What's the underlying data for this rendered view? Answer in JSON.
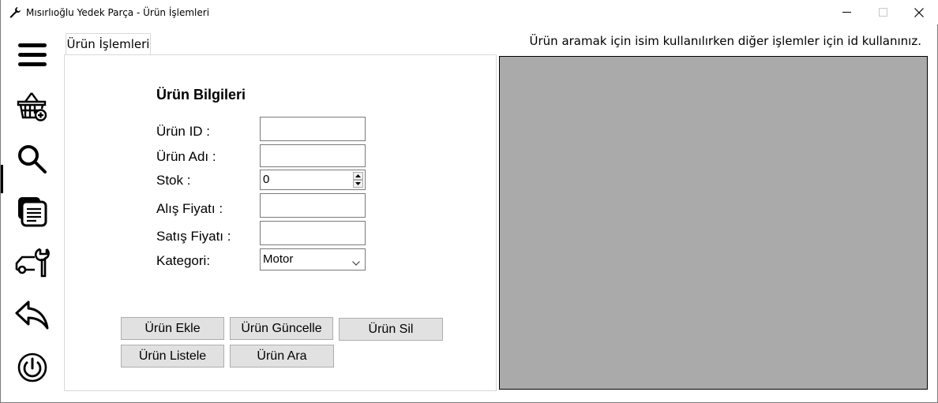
{
  "window": {
    "title": "Mısırlıoğlu Yedek Parça - Ürün İşlemleri",
    "icons": [
      "wrench-icon",
      "minimize-icon",
      "maximize-icon",
      "close-icon"
    ]
  },
  "sidebar": {
    "items": [
      {
        "icon": "menu-icon"
      },
      {
        "icon": "basket-add-icon"
      },
      {
        "icon": "search-icon"
      },
      {
        "icon": "documents-icon"
      },
      {
        "icon": "car-repair-icon"
      },
      {
        "icon": "back-arrow-icon"
      },
      {
        "icon": "power-icon"
      }
    ]
  },
  "tab": {
    "label": "Ürün İşlemleri"
  },
  "hint": "Ürün aramak için isim kullanılırken diğer işlemler için id kullanınız.",
  "form": {
    "title": "Ürün Bilgileri",
    "id_label": "Ürün ID :",
    "id_value": "",
    "name_label": "Ürün Adı :",
    "name_value": "",
    "stock_label": "Stok :",
    "stock_value": "0",
    "buy_price_label": "Alış Fiyatı :",
    "buy_price_value": "",
    "sell_price_label": "Satış Fiyatı :",
    "sell_price_value": "",
    "category_label": "Kategori:",
    "category_value": "Motor"
  },
  "buttons": {
    "add": "Ürün Ekle",
    "update": "Ürün Güncelle",
    "delete": "Ürün Sil",
    "list": "Ürün Listele",
    "search": "Ürün Ara"
  },
  "colors": {
    "grid_background": "#aaaaaa",
    "button_face": "#e1e1e1"
  }
}
